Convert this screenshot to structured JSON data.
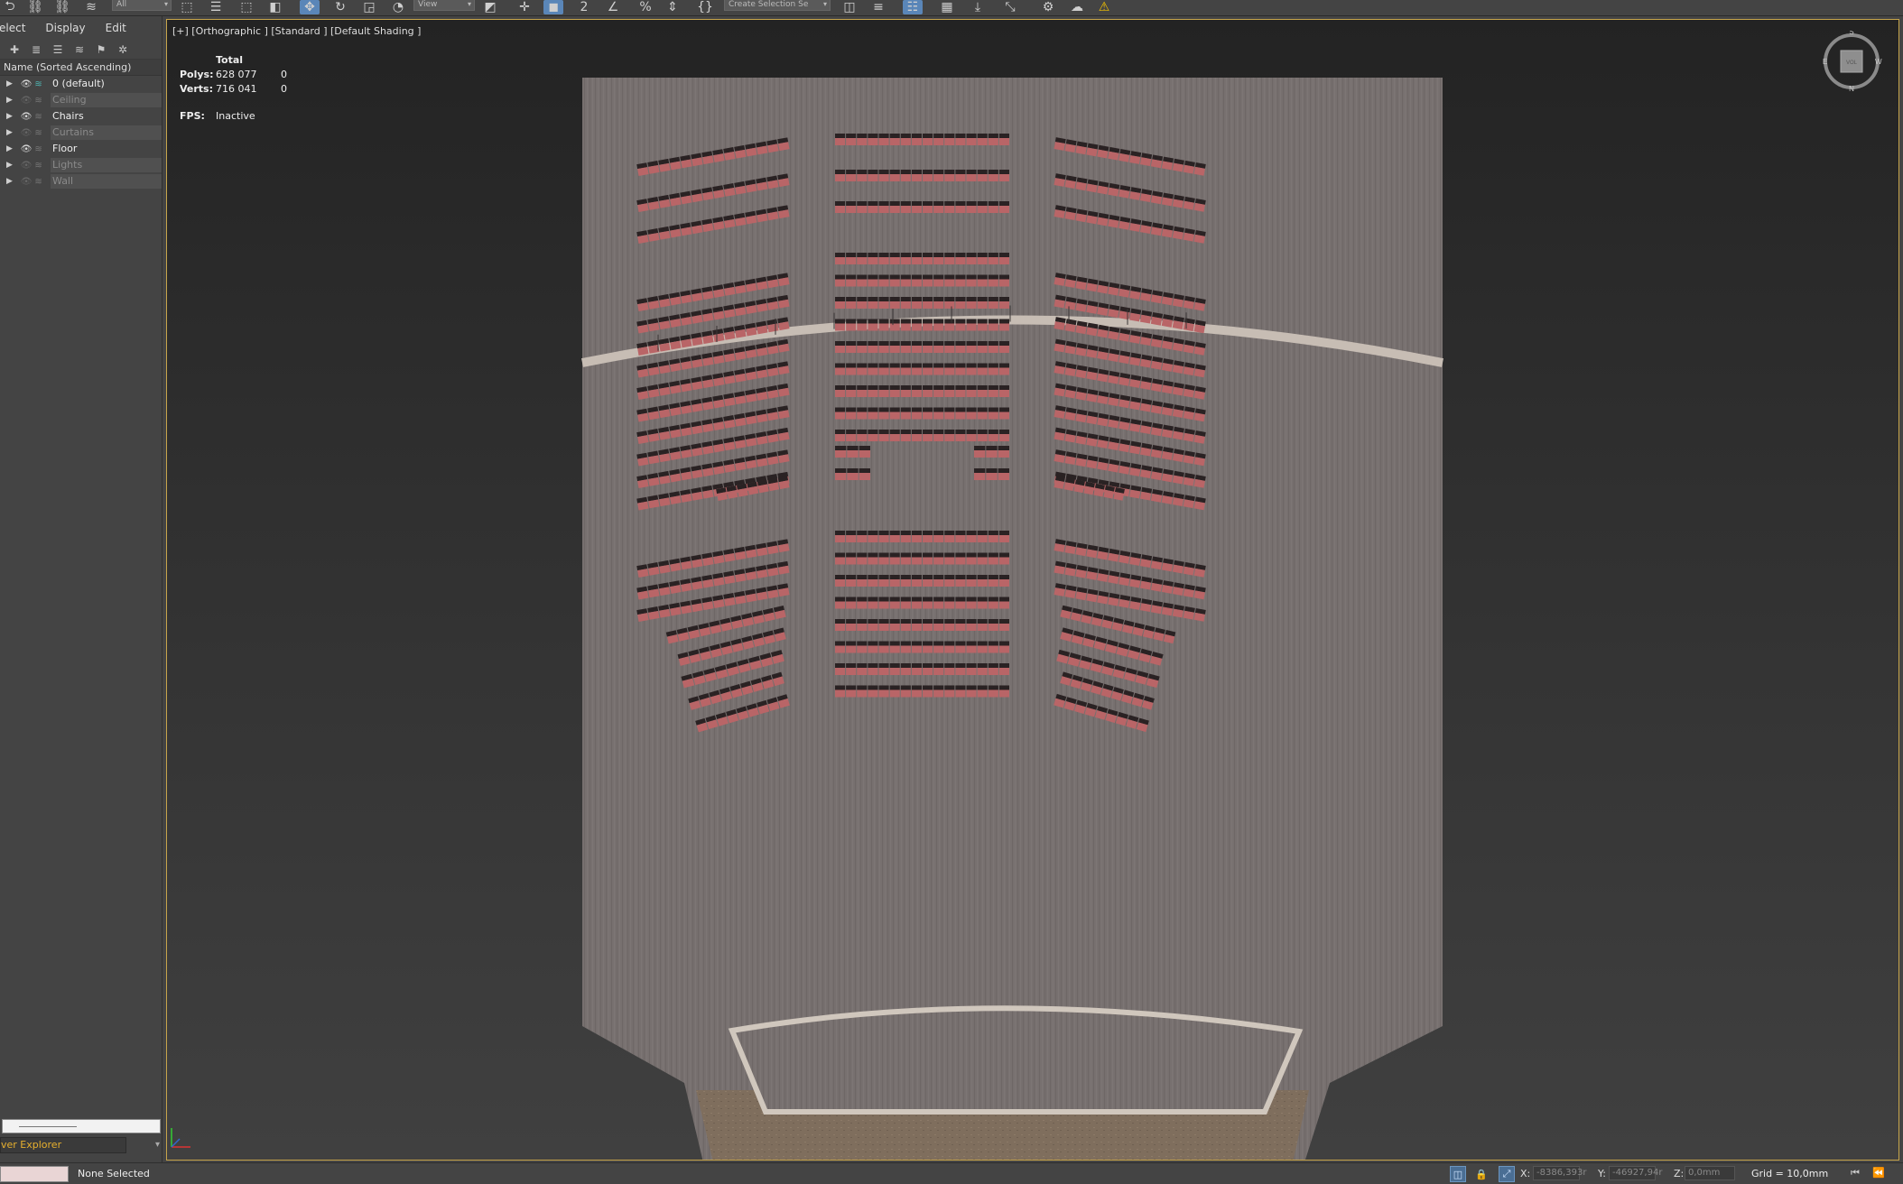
{
  "toolbar": {
    "filter_value": "All",
    "view_value": "View",
    "selection_set_value": "Create Selection Se"
  },
  "explorer": {
    "menu": [
      "elect",
      "Display",
      "Edit"
    ],
    "column_header": "Name (Sorted Ascending)",
    "layers": [
      {
        "name": "0 (default)",
        "visible": true,
        "current": true
      },
      {
        "name": "Ceiling",
        "visible": false,
        "current": false
      },
      {
        "name": "Chairs",
        "visible": true,
        "current": false
      },
      {
        "name": "Curtains",
        "visible": false,
        "current": false
      },
      {
        "name": "Floor",
        "visible": true,
        "current": false
      },
      {
        "name": "Lights",
        "visible": false,
        "current": false
      },
      {
        "name": "Wall",
        "visible": false,
        "current": false
      }
    ],
    "footer_label": "ver Explorer"
  },
  "viewport": {
    "label": "[+] [Orthographic ] [Standard ] [Default Shading ]",
    "stats_header": "Total",
    "polys_label": "Polys:",
    "polys_total": "628 077",
    "polys_selected": "0",
    "verts_label": "Verts:",
    "verts_total": "716 041",
    "verts_selected": "0",
    "fps_label": "FPS:",
    "fps_value": "Inactive",
    "viewcube": {
      "top": "S",
      "bottom": "N",
      "left": "E",
      "right": "W",
      "face": "VOL"
    }
  },
  "status": {
    "selection_text": "None Selected",
    "x_label": "X:",
    "x_value": "-8386,393r",
    "y_label": "Y:",
    "y_value": "-46927,94r",
    "z_label": "Z:",
    "z_value": "0,0mm",
    "grid_text": "Grid = 10,0mm"
  },
  "colors": {
    "floor": "#77706f",
    "seat": "#b96567",
    "seat_back": "#2a2223",
    "balcony_rail": "#c7bdb4",
    "stage_edge": "#d0c7bd",
    "stage": "#7f6e5d",
    "viewport_border": "#c7a54b",
    "layer_accent": "#4fb3b0"
  }
}
